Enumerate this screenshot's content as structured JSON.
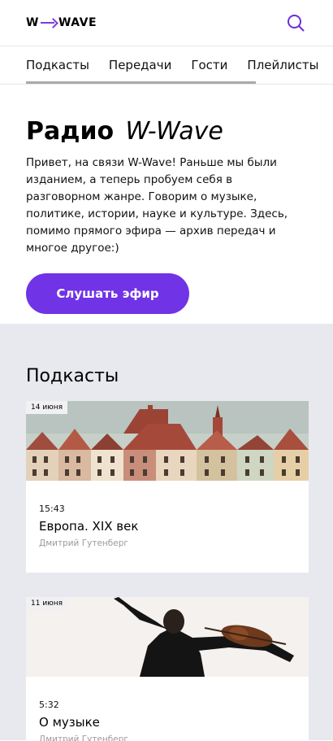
{
  "header": {
    "logo": {
      "left": "W",
      "right": "WAVE"
    },
    "search_icon": "search-icon"
  },
  "tabs": [
    "Подкасты",
    "Передачи",
    "Гости",
    "Плейлисты"
  ],
  "hero": {
    "title_bold": "Радио",
    "title_italic": "W-Wave",
    "description": "Привет, на связи W-Wave! Раньше мы были изданием, а теперь пробуем себя в разговорном жанре. Говорим о музыке, политике, истории, науке и культуре. Здесь, помимо прямого эфира — архив передач и многое другое:)",
    "listen_label": "Слушать эфир"
  },
  "podcasts": {
    "heading": "Подкасты",
    "items": [
      {
        "date": "14 июня",
        "time": "15:43",
        "title": "Европа. XIX век",
        "author": "Дмитрий Гутенберг"
      },
      {
        "date": "11 июня",
        "time": "5:32",
        "title": "О музыке",
        "author": "Дмитрий Гутенберг"
      }
    ]
  },
  "colors": {
    "accent": "#7033e6",
    "section_bg": "#e8e9ee"
  }
}
